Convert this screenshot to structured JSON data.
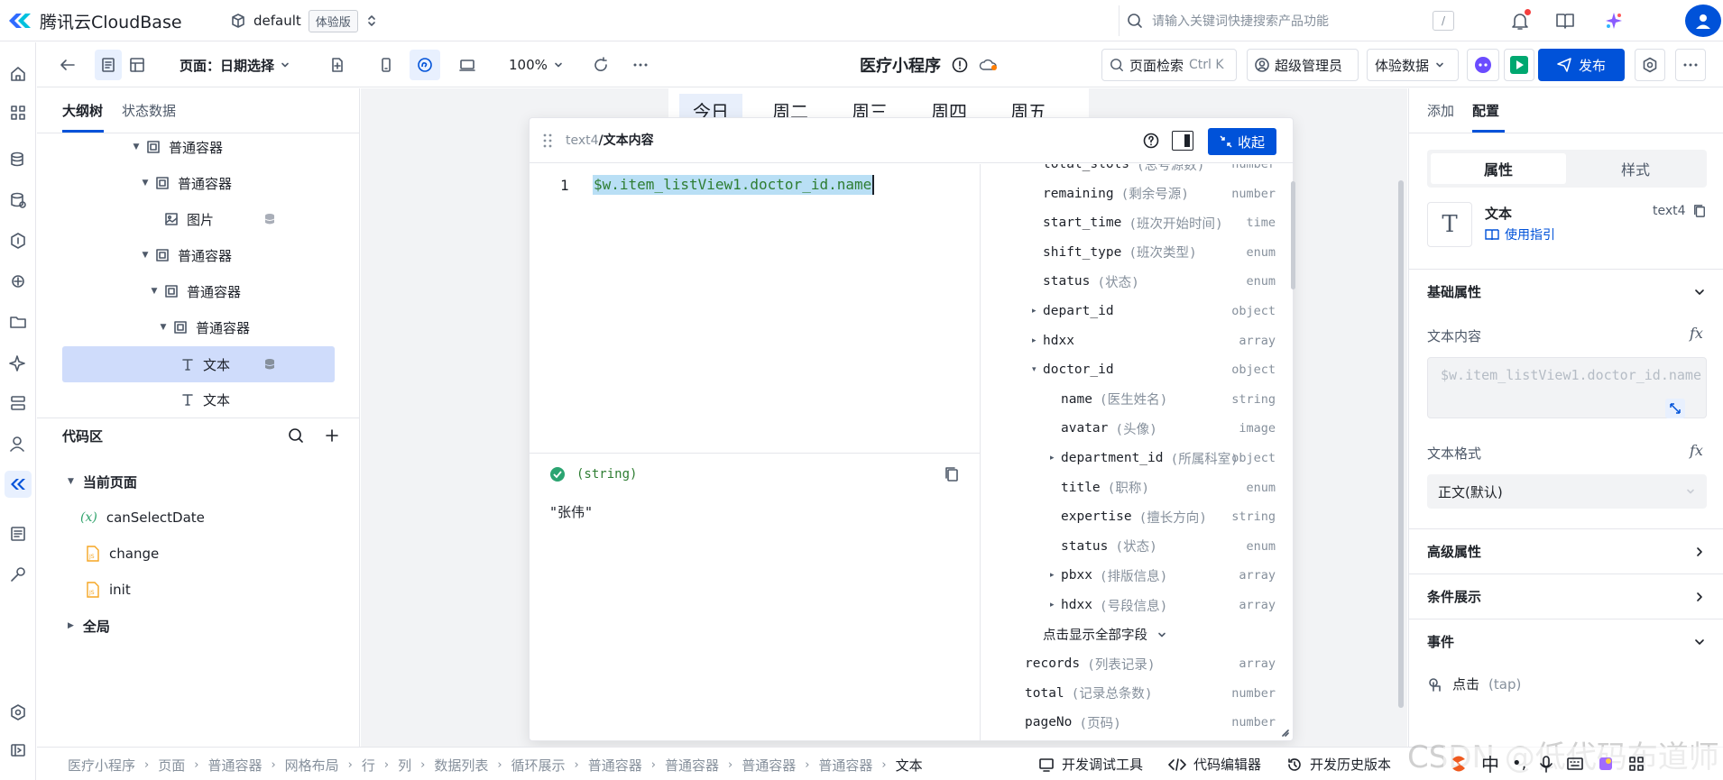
{
  "app": {
    "brand": "腾讯云CloudBase",
    "env_name": "default",
    "env_badge": "体验版"
  },
  "search": {
    "placeholder": "请输入关键词快捷搜索产品功能",
    "shortcut": "/"
  },
  "toolbar": {
    "page_label": "页面：日期选择",
    "zoom": "100%",
    "app_title": "医疗小程序",
    "page_search": "页面检索",
    "page_search_key": "Ctrl K",
    "role": "超级管理员",
    "data_mode": "体验数据",
    "publish": "发布"
  },
  "left_panel": {
    "tabs": [
      "大纲树",
      "状态数据"
    ],
    "tree": [
      {
        "label": "普通容器",
        "indent": 0
      },
      {
        "label": "普通容器",
        "indent": 1
      },
      {
        "label": "图片",
        "indent": 2
      },
      {
        "label": "普通容器",
        "indent": 1
      },
      {
        "label": "普通容器",
        "indent": 2
      },
      {
        "label": "普通容器",
        "indent": 3
      },
      {
        "label": "文本",
        "indent": 4
      },
      {
        "label": "文本",
        "indent": 4
      }
    ],
    "code_area": {
      "title": "代码区",
      "current_page": "当前页面",
      "items": [
        "canSelectDate",
        "change",
        "init"
      ],
      "global": "全局"
    }
  },
  "canvas": {
    "weekdays": [
      "今日",
      "周二",
      "周三",
      "周四",
      "周五"
    ]
  },
  "editor": {
    "path_prefix": "text4",
    "path_suffix": "/文本内容",
    "collapse_label": "收起",
    "line_number": "1",
    "code": "$w.item_listView1.doctor_id.name",
    "result_type": "(string)",
    "result_value": "\"张伟\"",
    "fields": [
      {
        "name": "total_slots",
        "desc": "(总号源数)",
        "type": "number",
        "level": 1,
        "caret": ""
      },
      {
        "name": "remaining",
        "desc": "(剩余号源)",
        "type": "number",
        "level": 1,
        "caret": ""
      },
      {
        "name": "start_time",
        "desc": "(班次开始时间)",
        "type": "time",
        "level": 1,
        "caret": ""
      },
      {
        "name": "shift_type",
        "desc": "(班次类型)",
        "type": "enum",
        "level": 1,
        "caret": ""
      },
      {
        "name": "status",
        "desc": "(状态)",
        "type": "enum",
        "level": 1,
        "caret": ""
      },
      {
        "name": "depart_id",
        "desc": "",
        "type": "object",
        "level": 1,
        "caret": "▸"
      },
      {
        "name": "hdxx",
        "desc": "",
        "type": "array",
        "level": 1,
        "caret": "▸"
      },
      {
        "name": "doctor_id",
        "desc": "",
        "type": "object",
        "level": 1,
        "caret": "▾"
      },
      {
        "name": "name",
        "desc": "(医生姓名)",
        "type": "string",
        "level": 2,
        "caret": ""
      },
      {
        "name": "avatar",
        "desc": "(头像)",
        "type": "image",
        "level": 2,
        "caret": ""
      },
      {
        "name": "department_id",
        "desc": "(所属科室)",
        "type": "object",
        "level": 2,
        "caret": "▸"
      },
      {
        "name": "title",
        "desc": "(职称)",
        "type": "enum",
        "level": 2,
        "caret": ""
      },
      {
        "name": "expertise",
        "desc": "(擅长方向)",
        "type": "string",
        "level": 2,
        "caret": ""
      },
      {
        "name": "status",
        "desc": "(状态)",
        "type": "enum",
        "level": 2,
        "caret": ""
      },
      {
        "name": "pbxx",
        "desc": "(排版信息)",
        "type": "array",
        "level": 2,
        "caret": "▸"
      },
      {
        "name": "hdxx",
        "desc": "(号段信息)",
        "type": "array",
        "level": 2,
        "caret": "▸"
      },
      {
        "name": "点击显示全部字段",
        "desc": "",
        "type": "",
        "level": 1,
        "caret": ""
      },
      {
        "name": "records",
        "desc": "(列表记录)",
        "type": "array",
        "level": 0,
        "caret": ""
      },
      {
        "name": "total",
        "desc": "(记录总条数)",
        "type": "number",
        "level": 0,
        "caret": ""
      },
      {
        "name": "pageNo",
        "desc": "(页码)",
        "type": "number",
        "level": 0,
        "caret": ""
      }
    ]
  },
  "right_panel": {
    "tabs": [
      "添加",
      "配置"
    ],
    "segments": [
      "属性",
      "样式"
    ],
    "component_name": "文本",
    "component_id": "text4",
    "guide_link": "使用指引",
    "sections": {
      "basic": "基础属性",
      "advanced": "高级属性",
      "conditional": "条件展示",
      "events": "事件"
    },
    "text_content_label": "文本内容",
    "text_content_value": "$w.item_listView1.doctor_id.name",
    "text_format_label": "文本格式",
    "text_format_value": "正文(默认)",
    "event_click": "点击",
    "event_click_code": "(tap)"
  },
  "footer": {
    "breadcrumbs": [
      "医疗小程序",
      "页面",
      "普通容器",
      "网格布局",
      "行",
      "列",
      "数据列表",
      "循环展示",
      "普通容器",
      "普通容器",
      "普通容器",
      "普通容器",
      "文本"
    ],
    "tools": [
      "开发调试工具",
      "代码编辑器",
      "开发历史版本"
    ]
  },
  "watermark": "CSDN @低代码布道师",
  "colors": {
    "primary": "#0052d9",
    "selected_row": "#cfdcfb",
    "code_green": "#2e7d32",
    "publish_green": "#00a870"
  }
}
